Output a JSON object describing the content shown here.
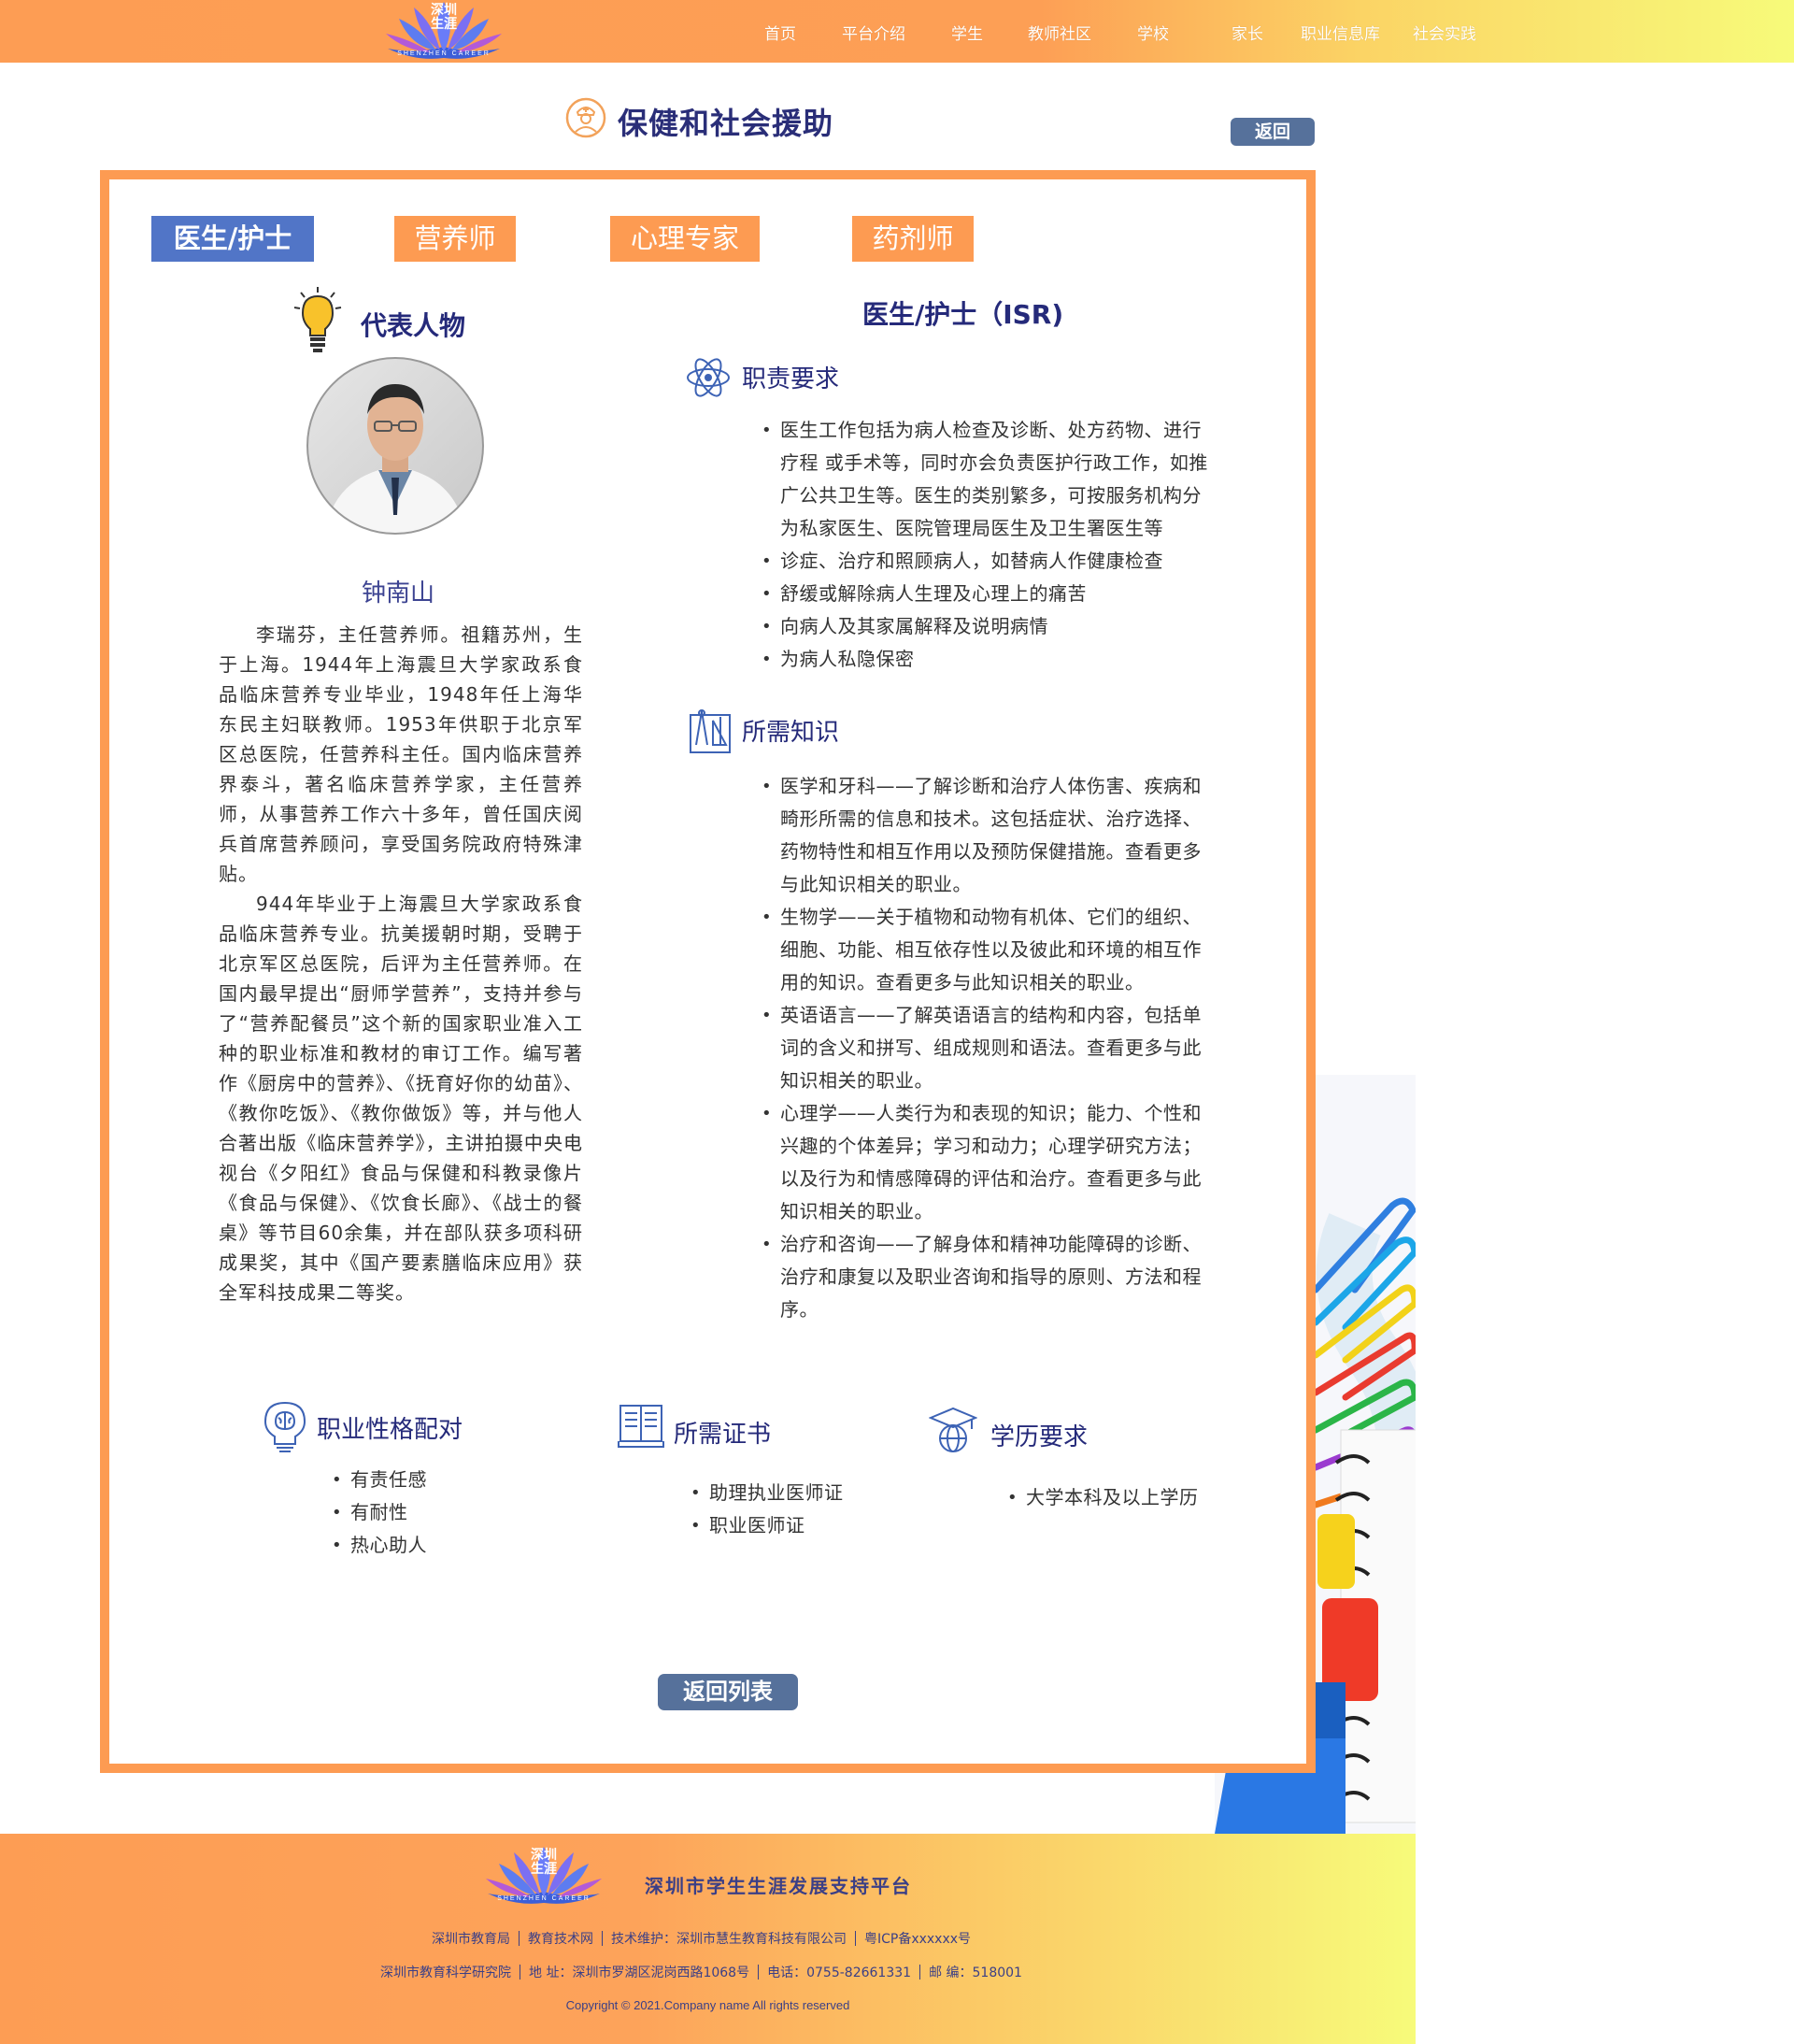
{
  "header": {
    "logo": {
      "text_line1": "深圳",
      "text_line2": "生涯",
      "subtitle": "SHENZHEN CAREER"
    },
    "nav": [
      "首页",
      "平台介绍",
      "学生",
      "教师社区",
      "学校",
      "家长",
      "职业信息库",
      "社会实践"
    ]
  },
  "page": {
    "title": "保健和社会援助",
    "back_button": "返回"
  },
  "tabs": [
    "医生/护士",
    "营养师",
    "心理专家",
    "药剂师"
  ],
  "representative": {
    "heading": "代表人物",
    "name": "钟南山",
    "bio": [
      "李瑞芬，主任营养师。祖籍苏州，生于上海。1944年上海震旦大学家政系食品临床营养专业毕业，1948年任上海华东民主妇联教师。1953年供职于北京军区总医院，任营养科主任。国内临床营养界泰斗，著名临床营养学家，主任营养师，从事营养工作六十多年，曾任国庆阅兵首席营养顾问，享受国务院政府特殊津贴。",
      "944年毕业于上海震旦大学家政系食品临床营养专业。抗美援朝时期，受聘于北京军区总医院，后评为主任营养师。在国内最早提出“厨师学营养”，支持并参与了“营养配餐员”这个新的国家职业准入工种的职业标准和教材的审订工作。编写著作《厨房中的营养》、《抚育好你的幼苗》、《教你吃饭》、《教你做饭》等，并与他人合著出版《临床营养学》，主讲拍摄中央电视台《夕阳红》食品与保健和科教录像片《食品与保健》、《饮食长廊》、《战士的餐桌》等节目60余集，并在部队获多项科研成果奖，其中《国产要素膳临床应用》获全军科技成果二等奖。"
    ]
  },
  "career": {
    "title": "医生/护士（ISR)",
    "duties": {
      "heading": "职责要求",
      "items": [
        "医生工作包括为病人检查及诊断、处方药物、进行疗程 或手术等，同时亦会负责医护行政工作，如推广公共卫生等。医生的类别繁多，可按服务机构分为私家医生、医院管理局医生及卫生署医生等",
        "诊症、治疗和照顾病人，如替病人作健康检查",
        "舒缓或解除病人生理及心理上的痛苦",
        "向病人及其家属解释及说明病情",
        "为病人私隐保密"
      ]
    },
    "knowledge": {
      "heading": "所需知识",
      "items": [
        "医学和牙科——了解诊断和治疗人体伤害、疾病和畸形所需的信息和技术。这包括症状、治疗选择、药物特性和相互作用以及预防保健措施。查看更多与此知识相关的职业。",
        "生物学——关于植物和动物有机体、它们的组织、细胞、功能、相互依存性以及彼此和环境的相互作用的知识。查看更多与此知识相关的职业。",
        "英语语言——了解英语语言的结构和内容，包括单词的含义和拼写、组成规则和语法。查看更多与此知识相关的职业。",
        "心理学——人类行为和表现的知识；能力、个性和兴趣的个体差异；学习和动力；心理学研究方法；以及行为和情感障碍的评估和治疗。查看更多与此知识相关的职业。",
        "治疗和咨询——了解身体和精神功能障碍的诊断、治疗和康复以及职业咨询和指导的原则、方法和程序。"
      ]
    },
    "personality": {
      "heading": "职业性格配对",
      "items": [
        "有责任感",
        "有耐性",
        "热心助人"
      ]
    },
    "certificates": {
      "heading": "所需证书",
      "items": [
        "助理执业医师证",
        "职业医师证"
      ]
    },
    "education": {
      "heading": "学历要求",
      "items": [
        "大学本科及以上学历"
      ]
    }
  },
  "return_list_button": "返回列表",
  "footer": {
    "slogan": "深圳市学生生涯发展支持平台",
    "line1": [
      "深圳市教育局",
      "教育技术网",
      "技术维护：深圳市慧生教育科技有限公司",
      "粤ICP备xxxxxx号"
    ],
    "line2": [
      "深圳市教育科学研究院",
      "地  址：深圳市罗湖区泥岗西路1068号",
      "电话：0755-82661331",
      "邮  编：518001"
    ],
    "copyright": "Copyright © 2021.Company name All rights reserved"
  },
  "colors": {
    "header_orange": "#fd9d54",
    "header_yellow": "#f7fb7a",
    "frame_border": "#fd9b52",
    "tab_active": "#5175c7",
    "button_slate": "#56719b",
    "heading_navy": "#252a7a",
    "icon_blue": "#3d63b5"
  }
}
